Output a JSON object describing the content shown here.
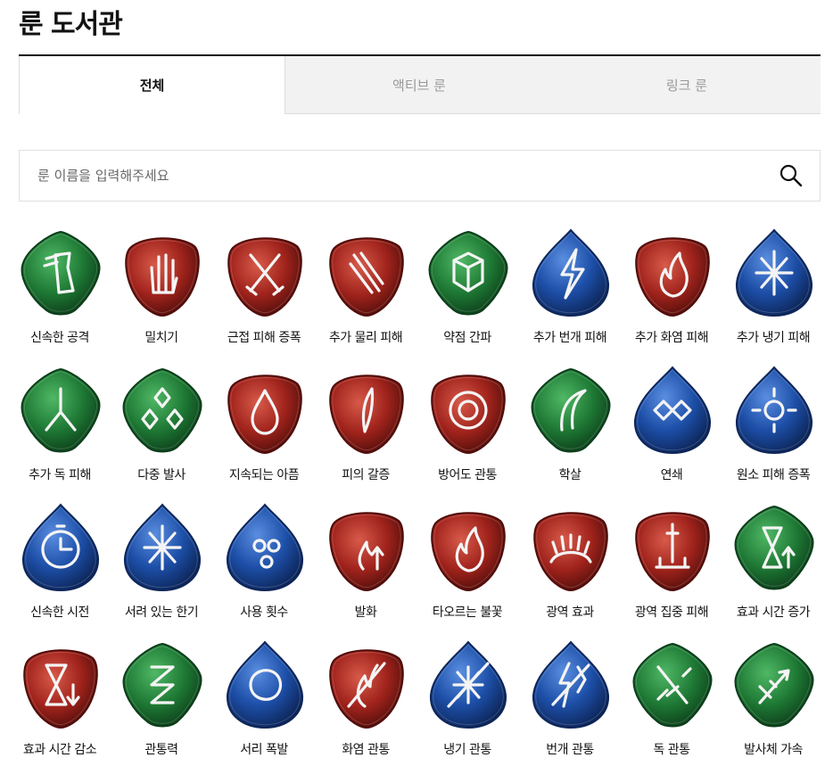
{
  "page_title": "룬 도서관",
  "tabs": [
    {
      "label": "전체",
      "active": true
    },
    {
      "label": "액티브 룬",
      "active": false
    },
    {
      "label": "링크 룬",
      "active": false
    }
  ],
  "search": {
    "placeholder": "룬 이름을 입력해주세요",
    "value": ""
  },
  "colors": {
    "green": "#1f7a35",
    "red": "#a0231c",
    "blue": "#1d4fa8"
  },
  "runes": [
    {
      "name": "신속한 공격",
      "color": "green",
      "shape": "diamond",
      "icon": "winged-boot-icon"
    },
    {
      "name": "밀치기",
      "color": "red",
      "shape": "shield",
      "icon": "palm-hand-icon"
    },
    {
      "name": "근접 피해 증폭",
      "color": "red",
      "shape": "shield",
      "icon": "crossed-swords-icon"
    },
    {
      "name": "추가 물리 피해",
      "color": "red",
      "shape": "shield",
      "icon": "slash-sword-icon"
    },
    {
      "name": "약점 간파",
      "color": "green",
      "shape": "diamond",
      "icon": "dice-icon"
    },
    {
      "name": "추가 번개 피해",
      "color": "blue",
      "shape": "drop",
      "icon": "lightning-icon"
    },
    {
      "name": "추가 화염 피해",
      "color": "red",
      "shape": "shield",
      "icon": "flame-icon"
    },
    {
      "name": "추가 냉기 피해",
      "color": "blue",
      "shape": "drop",
      "icon": "snowflake-icon"
    },
    {
      "name": "추가 독 피해",
      "color": "green",
      "shape": "diamond",
      "icon": "poison-fork-icon"
    },
    {
      "name": "다중 발사",
      "color": "green",
      "shape": "diamond",
      "icon": "multi-diamond-icon"
    },
    {
      "name": "지속되는 아픔",
      "color": "red",
      "shape": "shield",
      "icon": "blood-drop-icon"
    },
    {
      "name": "피의 갈증",
      "color": "red",
      "shape": "shield",
      "icon": "blood-claw-icon"
    },
    {
      "name": "방어도 관통",
      "color": "red",
      "shape": "shield",
      "icon": "broken-ring-icon"
    },
    {
      "name": "학살",
      "color": "green",
      "shape": "diamond",
      "icon": "scythe-icon"
    },
    {
      "name": "연쇄",
      "color": "blue",
      "shape": "drop",
      "icon": "chain-link-icon"
    },
    {
      "name": "원소 피해 증폭",
      "color": "blue",
      "shape": "drop",
      "icon": "element-sun-icon"
    },
    {
      "name": "신속한 시전",
      "color": "blue",
      "shape": "drop",
      "icon": "stopwatch-icon"
    },
    {
      "name": "서려 있는 한기",
      "color": "blue",
      "shape": "drop",
      "icon": "snowflake-icon"
    },
    {
      "name": "사용 횟수",
      "color": "blue",
      "shape": "drop",
      "icon": "three-dots-icon"
    },
    {
      "name": "발화",
      "color": "red",
      "shape": "shield",
      "icon": "ignite-arrow-icon"
    },
    {
      "name": "타오르는 불꽃",
      "color": "red",
      "shape": "shield",
      "icon": "flame-icon"
    },
    {
      "name": "광역 효과",
      "color": "red",
      "shape": "shield",
      "icon": "burst-ring-icon"
    },
    {
      "name": "광역 집중 피해",
      "color": "red",
      "shape": "shield",
      "icon": "sword-ground-icon"
    },
    {
      "name": "효과 시간 증가",
      "color": "green",
      "shape": "diamond",
      "icon": "hourglass-up-icon"
    },
    {
      "name": "효과 시간 감소",
      "color": "red",
      "shape": "shield",
      "icon": "hourglass-down-icon"
    },
    {
      "name": "관통력",
      "color": "green",
      "shape": "diamond",
      "icon": "pierce-stripes-icon"
    },
    {
      "name": "서리 폭발",
      "color": "blue",
      "shape": "drop",
      "icon": "frost-burst-icon"
    },
    {
      "name": "화염 관통",
      "color": "red",
      "shape": "shield",
      "icon": "fire-pierce-icon"
    },
    {
      "name": "냉기 관통",
      "color": "blue",
      "shape": "drop",
      "icon": "ice-pierce-icon"
    },
    {
      "name": "번개 관통",
      "color": "blue",
      "shape": "drop",
      "icon": "lightning-pierce-icon"
    },
    {
      "name": "독 관통",
      "color": "green",
      "shape": "diamond",
      "icon": "poison-pierce-icon"
    },
    {
      "name": "발사체 가속",
      "color": "green",
      "shape": "diamond",
      "icon": "arrows-speed-icon"
    }
  ]
}
